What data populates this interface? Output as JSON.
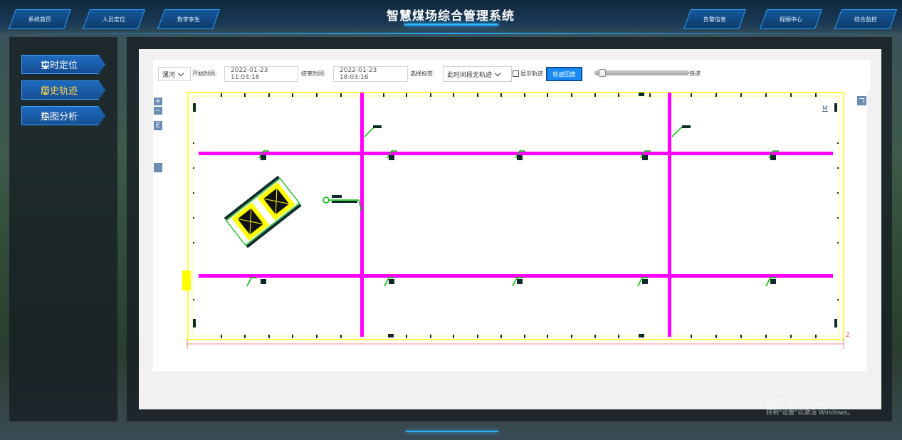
{
  "header": {
    "title": "智慧煤场综合管理系统",
    "left_nav": [
      "系统首页",
      "人员定位",
      "数字孪生"
    ],
    "right_nav": [
      "告警信息",
      "视频中心",
      "综合监控"
    ]
  },
  "sidebar": {
    "items": [
      {
        "label": "实时定位",
        "icon": "monitor-icon",
        "active": false
      },
      {
        "label": "历史轨迹",
        "icon": "monitor-icon",
        "active": true
      },
      {
        "label": "热图分析",
        "icon": "monitor-icon",
        "active": false
      }
    ]
  },
  "toolbar": {
    "area_select": "漯河",
    "start_label": "开始时间:",
    "start_value": "2022-01-23 11:03:16",
    "end_label": "结束时间:",
    "end_value": "2022-01-23 18:03:16",
    "tag_label": "选择标签:",
    "tag_select": "此时间段无轨迹",
    "show_track_label": "显示轨迹",
    "show_track_checked": false,
    "play_button": "轨迹回放",
    "speed_label": "快进",
    "speed_level": 0.05
  },
  "map": {
    "zoom_in": "+",
    "zoom_out": "−",
    "e_button": "E",
    "scale_label": "M",
    "corner_number": "2",
    "colors": {
      "beam": "#ff00ff",
      "wall": "#ffff00",
      "equipment": "#00cc00"
    }
  },
  "watermark": {
    "line1": "激活 Windows",
    "line2": "转到\"设置\"以激活 Windows。"
  }
}
